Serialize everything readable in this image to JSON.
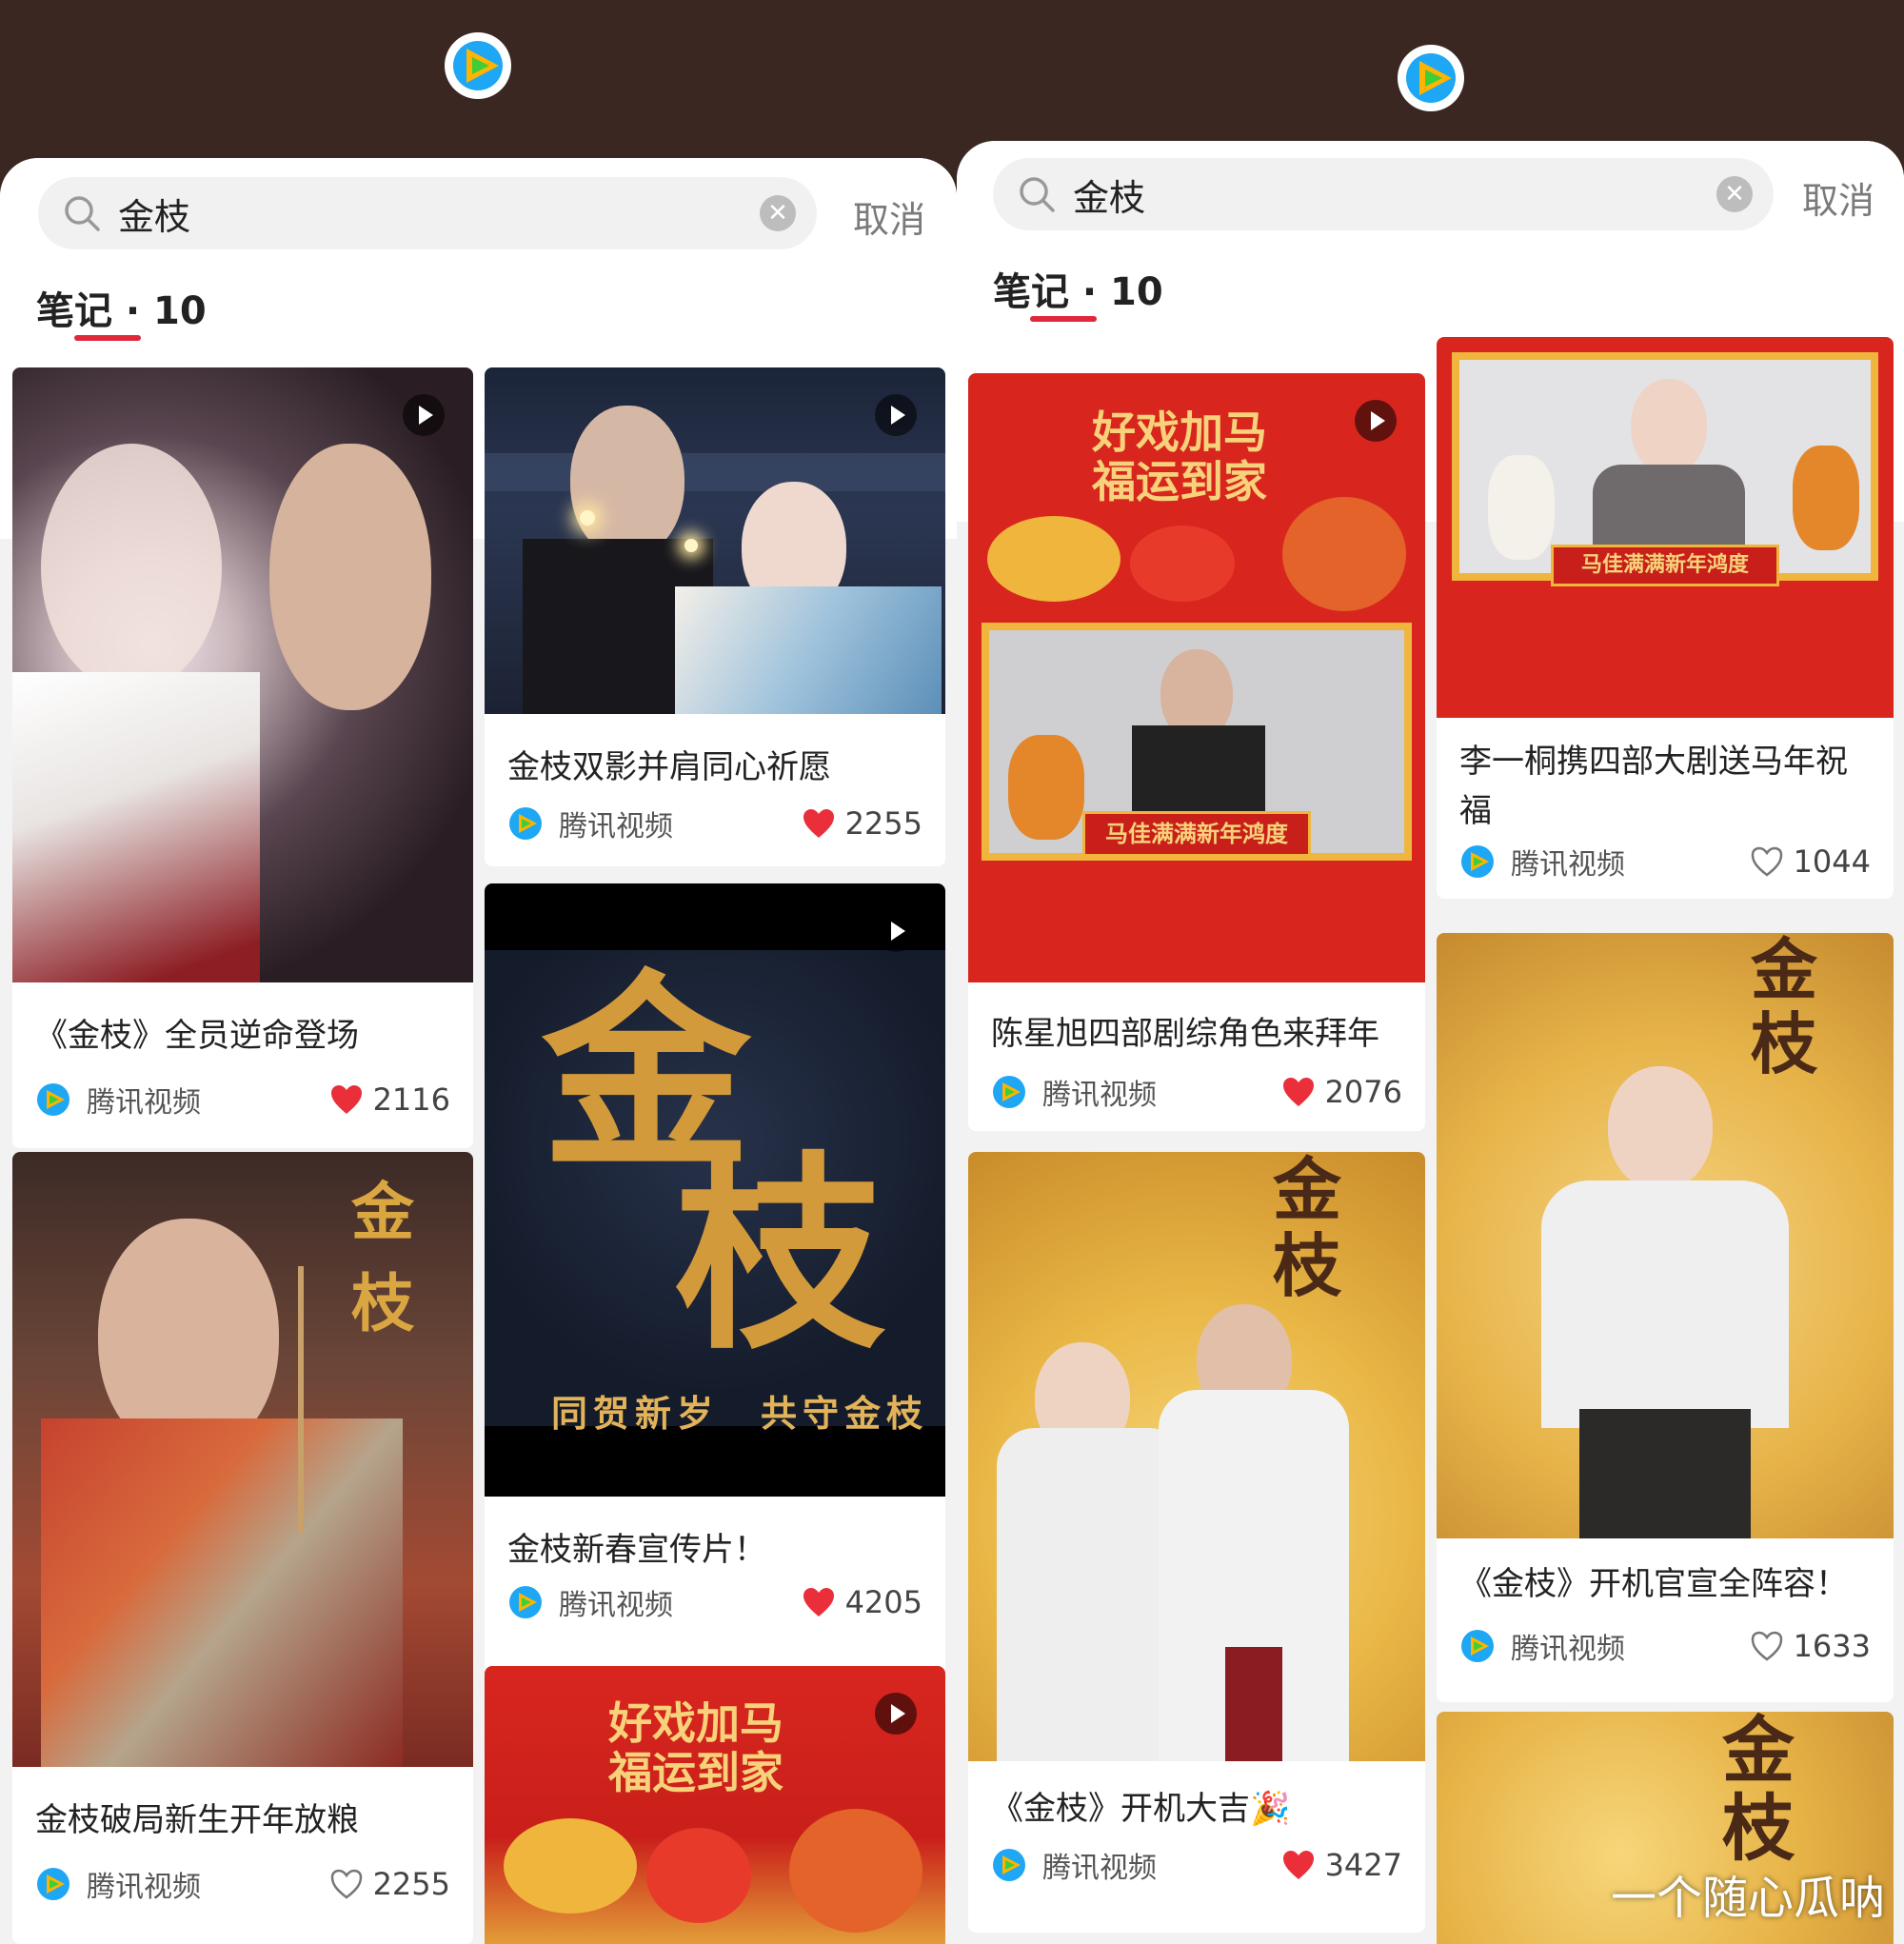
{
  "app": {
    "name_icon": "tencent-video-play-icon"
  },
  "search": {
    "query": "金枝",
    "cancel_label": "取消",
    "clear_icon": "clear-icon"
  },
  "tab": {
    "label": "笔记",
    "separator": " · ",
    "count": "10"
  },
  "source": "腾讯视频",
  "left_cards": [
    {
      "title": "《金枝》全员逆命登场",
      "likes": "2116",
      "liked": true
    },
    {
      "title": "金枝破局新生开年放粮",
      "likes": "2255",
      "liked": false
    },
    {
      "title": "金枝双影并肩同心祈愿",
      "likes": "2255",
      "liked": true
    },
    {
      "title": "金枝新春宣传片！",
      "likes": "4205",
      "liked": true
    }
  ],
  "right_cards": [
    {
      "title": "陈星旭四部剧综角色来拜年",
      "likes": "2076",
      "liked": true
    },
    {
      "title": "《金枝》开机大吉🎉",
      "likes": "3427",
      "liked": true
    },
    {
      "title": "李一桐携四部大剧送马年祝福",
      "likes": "1044",
      "liked": false
    },
    {
      "title": "《金枝》开机官宣全阵容！",
      "likes": "1633",
      "liked": false
    }
  ],
  "overlays": {
    "promo_line1": "好戏加马",
    "promo_line2": "福运到家",
    "banner_text": "马佳满满新年鸿度",
    "poster_title_1": "金",
    "poster_title_2": "枝",
    "poster_slogan": "同贺新岁　共守金枝"
  },
  "watermark": "一个随心瓜呐",
  "colors": {
    "accent": "#e0283a",
    "brand_dark": "#3a2722",
    "festive_red": "#d8261f",
    "gold": "#d9a641"
  }
}
